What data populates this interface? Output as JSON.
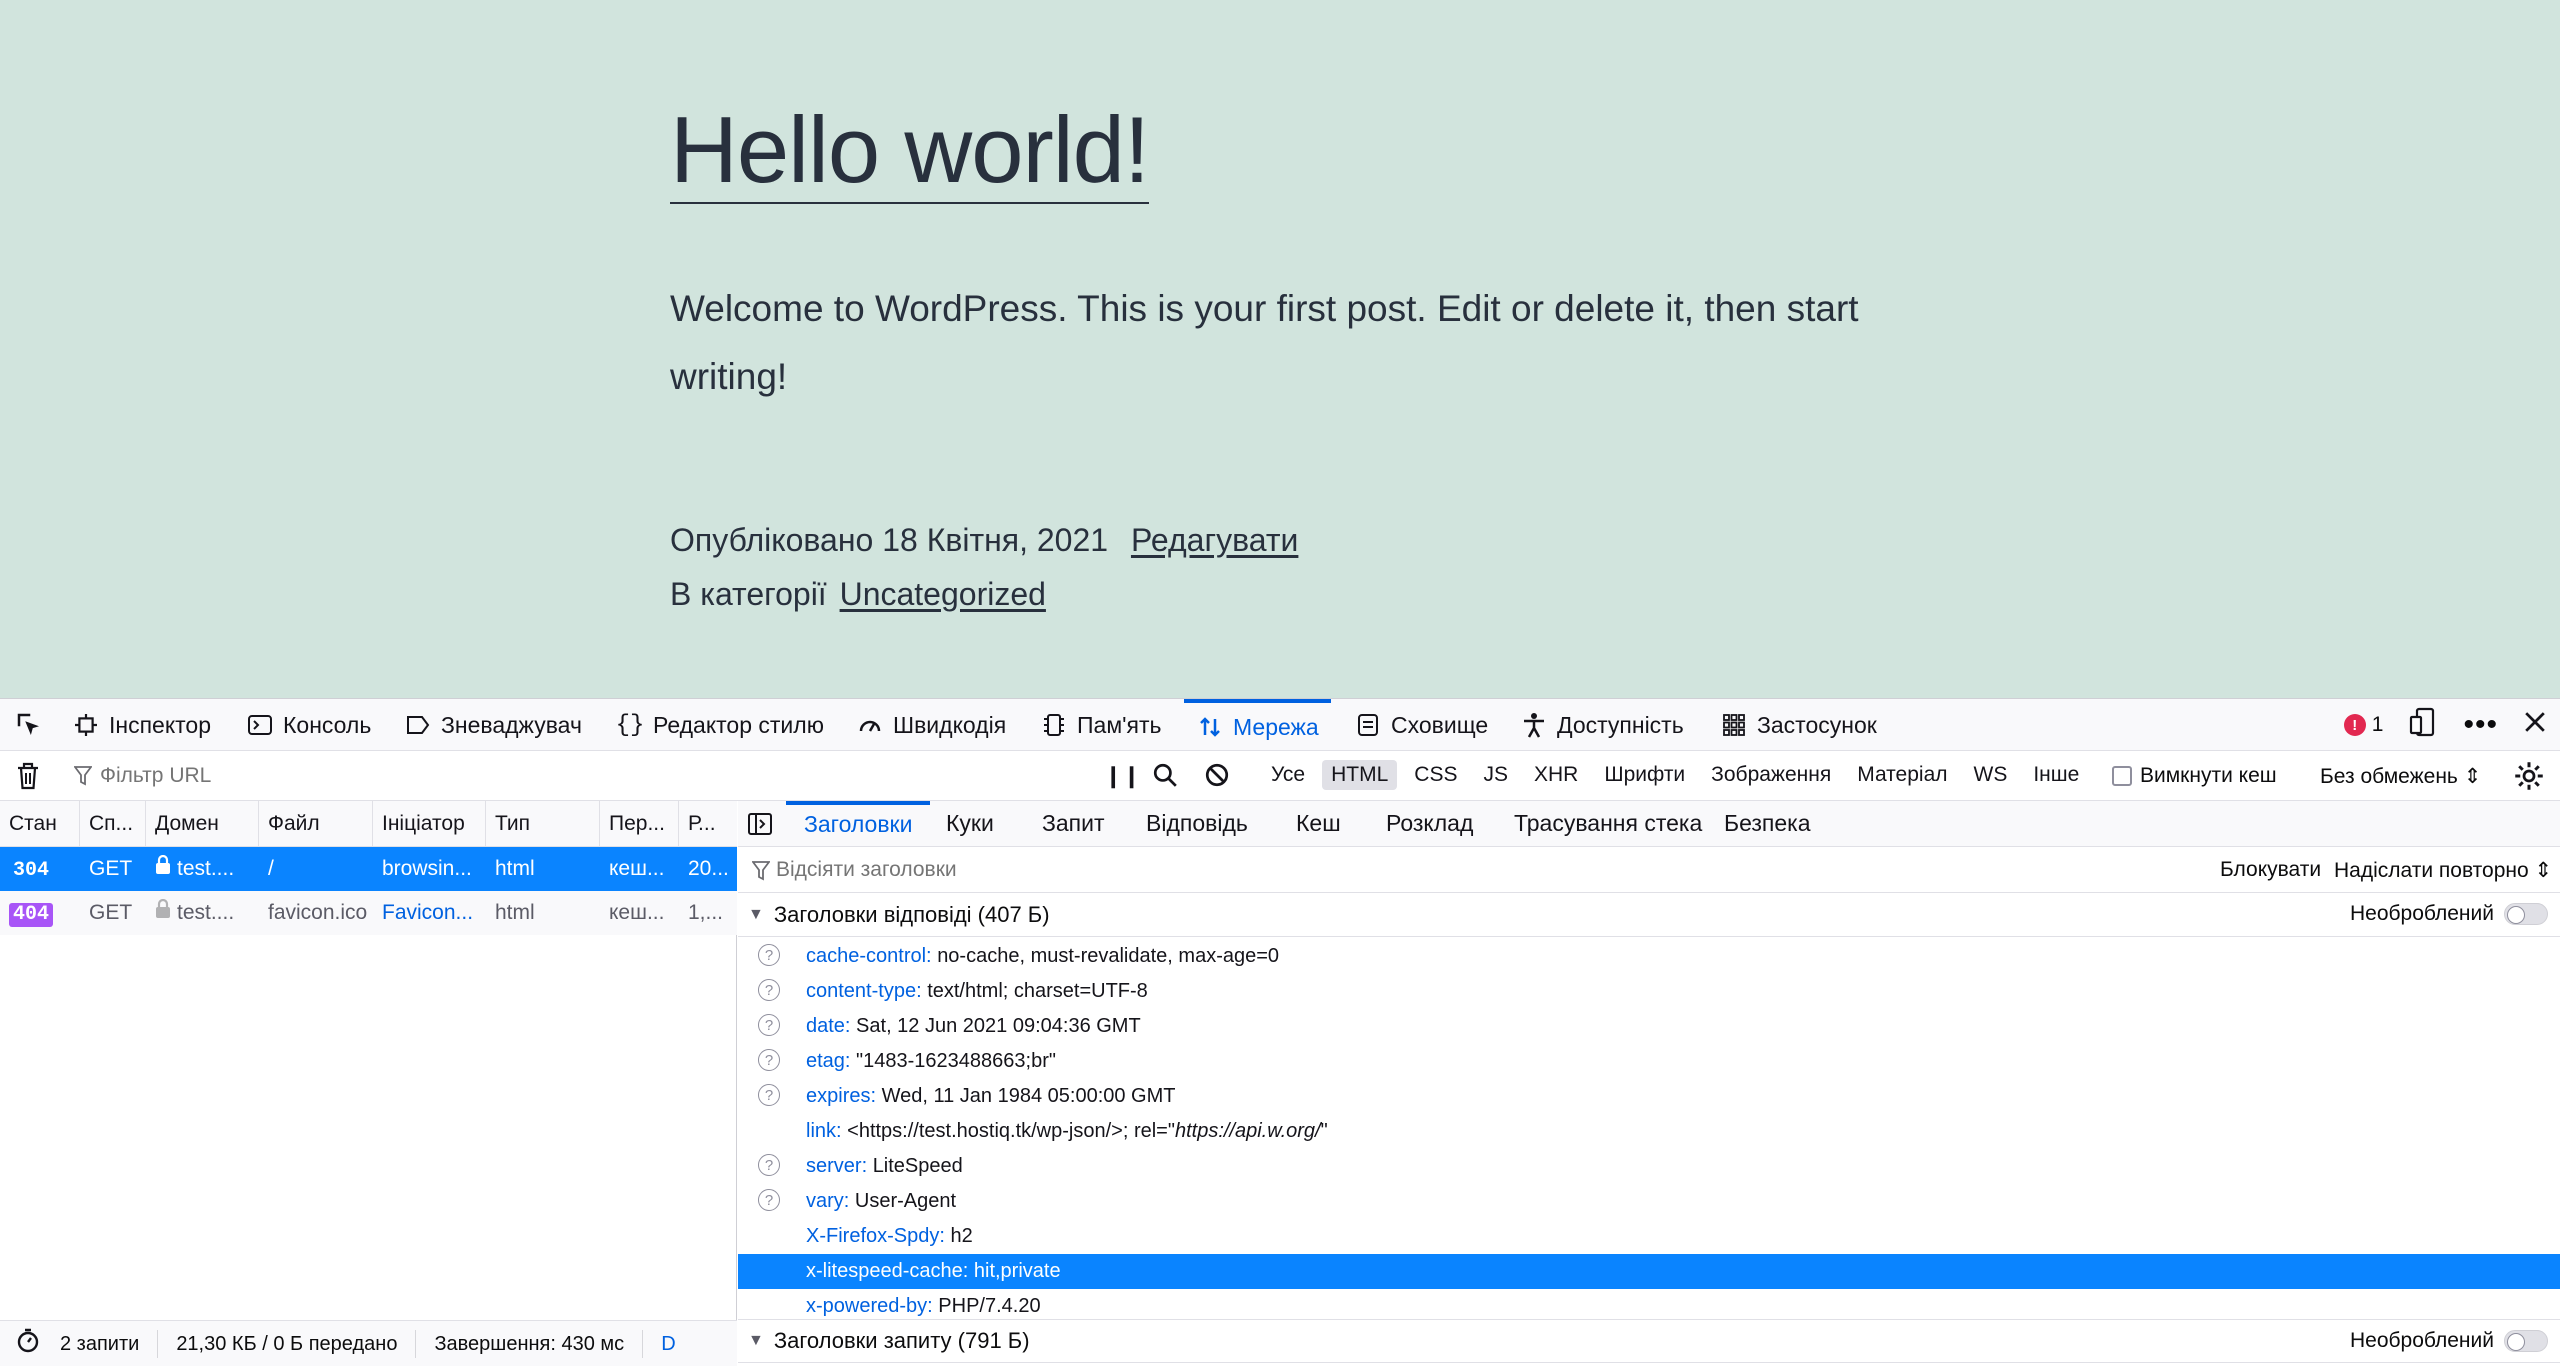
{
  "site": {
    "title": "Hello world!",
    "body": "Welcome to WordPress. This is your first post. Edit or delete it, then start writing!",
    "published_prefix": "Опубліковано 18 Квітня, 2021",
    "edit_link": "Редагувати",
    "category_prefix": "В категорії",
    "category_link": "Uncategorized"
  },
  "devtools": {
    "tabs": [
      "Інспектор",
      "Консоль",
      "Зневаджувач",
      "Редактор стилю",
      "Швидкодія",
      "Пам'ять",
      "Мережа",
      "Сховище",
      "Доступність",
      "Застосунок"
    ],
    "active_tab": "Мережа",
    "error_count": "1"
  },
  "toolbar": {
    "filter_placeholder": "Фільтр URL",
    "type_filters": [
      "Усе",
      "HTML",
      "CSS",
      "JS",
      "XHR",
      "Шрифти",
      "Зображення",
      "Матеріал",
      "WS",
      "Інше"
    ],
    "active_filter": "HTML",
    "disable_cache": "Вимкнути кеш",
    "throttle": "Без обмежень ⇕"
  },
  "requests": {
    "columns": [
      "Стан",
      "Сп...",
      "Домен",
      "Файл",
      "Ініціатор",
      "Тип",
      "Пер...",
      "Р..."
    ],
    "rows": [
      {
        "status": "304",
        "method": "GET",
        "domain": "test....",
        "file": "/",
        "initiator": "browsin...",
        "type": "html",
        "transferred": "кеш...",
        "size": "20..."
      },
      {
        "status": "404",
        "method": "GET",
        "domain": "test....",
        "file": "favicon.ico",
        "initiator": "Favicon...",
        "type": "html",
        "transferred": "кеш...",
        "size": "1,..."
      }
    ]
  },
  "status_bar": {
    "requests": "2 запити",
    "transferred": "21,30 КБ / 0 Б передано",
    "finish": "Завершення: 430 мс",
    "dom": "D"
  },
  "details": {
    "tabs": [
      "Заголовки",
      "Куки",
      "Запит",
      "Відповідь",
      "Кеш",
      "Розклад",
      "Трасування стека",
      "Безпека"
    ],
    "active_tab": "Заголовки",
    "filter_placeholder": "Відсіяти заголовки",
    "block": "Блокувати",
    "resend": "Надіслати повторно ⇕",
    "response_section": "Заголовки відповіді (407 Б)",
    "raw_label": "Необроблений",
    "request_section": "Заголовки запиту (791 Б)",
    "headers": [
      {
        "name": "cache-control:",
        "value": "no-cache, must-revalidate, max-age=0",
        "help": true
      },
      {
        "name": "content-type:",
        "value": "text/html; charset=UTF-8",
        "help": true
      },
      {
        "name": "date:",
        "value": "Sat, 12 Jun 2021 09:04:36 GMT",
        "help": true
      },
      {
        "name": "etag:",
        "value": "\"1483-1623488663;br\"",
        "help": true
      },
      {
        "name": "expires:",
        "value": "Wed, 11 Jan 1984 05:00:00 GMT",
        "help": true
      },
      {
        "name": "link:",
        "value_prefix": "<https://test.hostiq.tk/wp-json/>; rel=\"",
        "value_italic": "https://api.w.org/",
        "value_suffix": "\"",
        "help": false
      },
      {
        "name": "server:",
        "value": "LiteSpeed",
        "help": true
      },
      {
        "name": "vary:",
        "value": "User-Agent",
        "help": true
      },
      {
        "name": "X-Firefox-Spdy:",
        "value": "h2",
        "help": false
      },
      {
        "name": "x-litespeed-cache:",
        "value": "hit,private",
        "help": false,
        "selected": true
      },
      {
        "name": "x-powered-by:",
        "value": "PHP/7.4.20",
        "help": false
      }
    ]
  },
  "colors": {
    "site_bg": "#d1e4dd",
    "accent": "#0061e0",
    "selection": "#0a84ff",
    "error": "#e22850"
  }
}
